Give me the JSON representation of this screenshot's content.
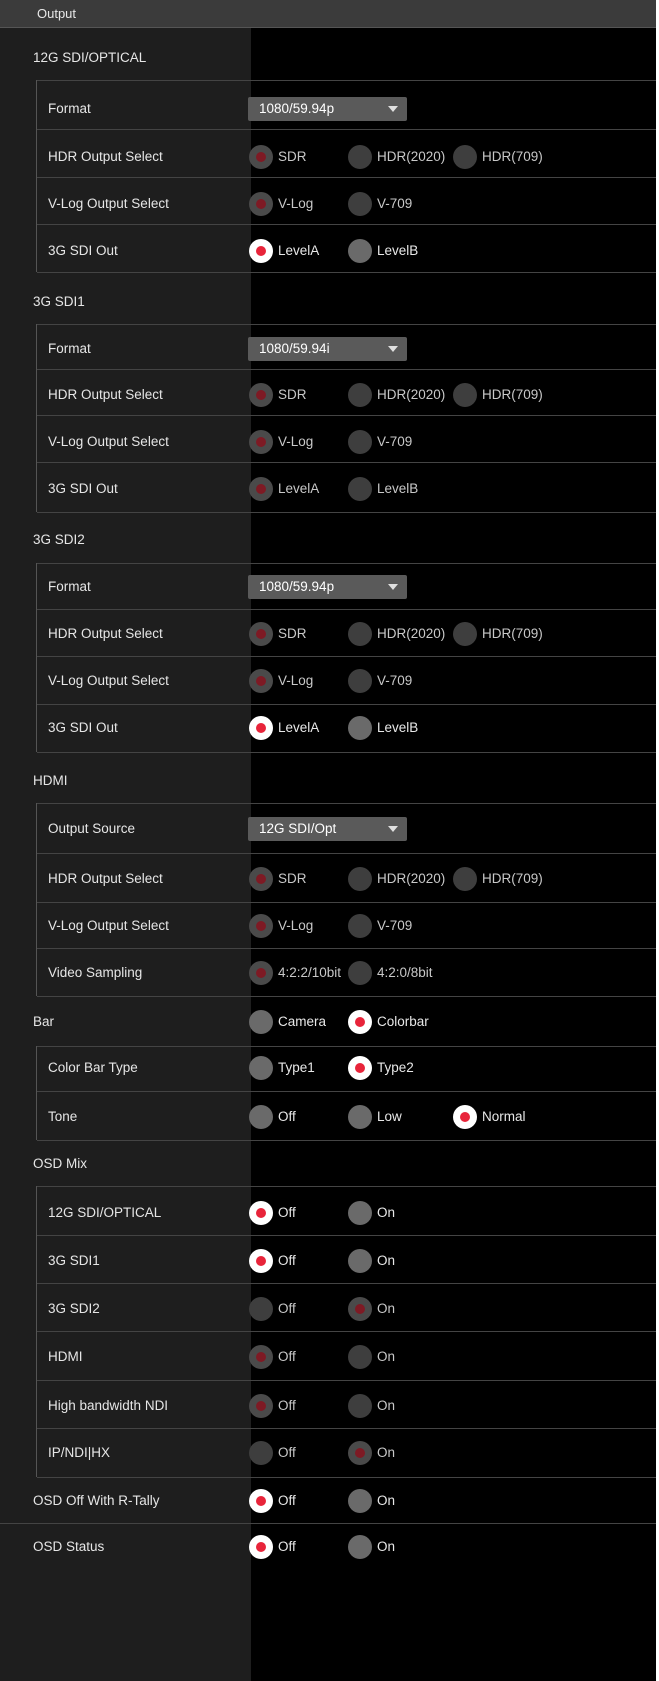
{
  "header": {
    "title": "Output"
  },
  "sections": [
    {
      "id": "sdi12g",
      "title": "12G SDI/OPTICAL",
      "rows": [
        {
          "label": "Format",
          "type": "select",
          "value": "1080/59.94p"
        },
        {
          "label": "HDR Output Select",
          "type": "radio",
          "enabled": false,
          "options": [
            {
              "label": "SDR",
              "selected": true
            },
            {
              "label": "HDR(2020)",
              "selected": false
            },
            {
              "label": "HDR(709)",
              "selected": false
            }
          ]
        },
        {
          "label": "V-Log Output Select",
          "type": "radio",
          "enabled": false,
          "options": [
            {
              "label": "V-Log",
              "selected": true
            },
            {
              "label": "V-709",
              "selected": false
            }
          ]
        },
        {
          "label": "3G SDI Out",
          "type": "radio",
          "enabled": true,
          "options": [
            {
              "label": "LevelA",
              "selected": true
            },
            {
              "label": "LevelB",
              "selected": false
            }
          ]
        }
      ]
    },
    {
      "id": "sdi3g1",
      "title": "3G SDI1",
      "rows": [
        {
          "label": "Format",
          "type": "select",
          "value": "1080/59.94i"
        },
        {
          "label": "HDR Output Select",
          "type": "radio",
          "enabled": false,
          "options": [
            {
              "label": "SDR",
              "selected": true
            },
            {
              "label": "HDR(2020)",
              "selected": false
            },
            {
              "label": "HDR(709)",
              "selected": false
            }
          ]
        },
        {
          "label": "V-Log Output Select",
          "type": "radio",
          "enabled": false,
          "options": [
            {
              "label": "V-Log",
              "selected": true
            },
            {
              "label": "V-709",
              "selected": false
            }
          ]
        },
        {
          "label": "3G SDI Out",
          "type": "radio",
          "enabled": false,
          "options": [
            {
              "label": "LevelA",
              "selected": true
            },
            {
              "label": "LevelB",
              "selected": false
            }
          ]
        }
      ]
    },
    {
      "id": "sdi3g2",
      "title": "3G SDI2",
      "rows": [
        {
          "label": "Format",
          "type": "select",
          "value": "1080/59.94p"
        },
        {
          "label": "HDR Output Select",
          "type": "radio",
          "enabled": false,
          "options": [
            {
              "label": "SDR",
              "selected": true
            },
            {
              "label": "HDR(2020)",
              "selected": false
            },
            {
              "label": "HDR(709)",
              "selected": false
            }
          ]
        },
        {
          "label": "V-Log Output Select",
          "type": "radio",
          "enabled": false,
          "options": [
            {
              "label": "V-Log",
              "selected": true
            },
            {
              "label": "V-709",
              "selected": false
            }
          ]
        },
        {
          "label": "3G SDI Out",
          "type": "radio",
          "enabled": true,
          "options": [
            {
              "label": "LevelA",
              "selected": true
            },
            {
              "label": "LevelB",
              "selected": false
            }
          ]
        }
      ]
    },
    {
      "id": "hdmi",
      "title": "HDMI",
      "rows": [
        {
          "label": "Output Source",
          "type": "select",
          "value": "12G SDI/Opt"
        },
        {
          "label": "HDR Output Select",
          "type": "radio",
          "enabled": false,
          "options": [
            {
              "label": "SDR",
              "selected": true
            },
            {
              "label": "HDR(2020)",
              "selected": false
            },
            {
              "label": "HDR(709)",
              "selected": false
            }
          ]
        },
        {
          "label": "V-Log Output Select",
          "type": "radio",
          "enabled": false,
          "options": [
            {
              "label": "V-Log",
              "selected": true
            },
            {
              "label": "V-709",
              "selected": false
            }
          ]
        },
        {
          "label": "Video Sampling",
          "type": "radio",
          "enabled": false,
          "options": [
            {
              "label": "4:2:2/10bit",
              "selected": true
            },
            {
              "label": "4:2:0/8bit",
              "selected": false
            }
          ]
        }
      ]
    },
    {
      "id": "bar",
      "title": "Bar",
      "options": [
        {
          "label": "Camera",
          "selected": false
        },
        {
          "label": "Colorbar",
          "selected": true
        }
      ],
      "rows": [
        {
          "label": "Color Bar Type",
          "type": "radio",
          "enabled": true,
          "options": [
            {
              "label": "Type1",
              "selected": false
            },
            {
              "label": "Type2",
              "selected": true
            }
          ]
        },
        {
          "label": "Tone",
          "type": "radio",
          "enabled": true,
          "options": [
            {
              "label": "Off",
              "selected": false
            },
            {
              "label": "Low",
              "selected": false
            },
            {
              "label": "Normal",
              "selected": true
            }
          ]
        }
      ]
    },
    {
      "id": "osdmix",
      "title": "OSD Mix",
      "rows": [
        {
          "label": "12G SDI/OPTICAL",
          "type": "radio",
          "enabled": true,
          "options": [
            {
              "label": "Off",
              "selected": true
            },
            {
              "label": "On",
              "selected": false
            }
          ]
        },
        {
          "label": "3G SDI1",
          "type": "radio",
          "enabled": true,
          "options": [
            {
              "label": "Off",
              "selected": true
            },
            {
              "label": "On",
              "selected": false
            }
          ]
        },
        {
          "label": "3G SDI2",
          "type": "radio",
          "enabled": false,
          "options": [
            {
              "label": "Off",
              "selected": false
            },
            {
              "label": "On",
              "selected": true
            }
          ]
        },
        {
          "label": "HDMI",
          "type": "radio",
          "enabled": false,
          "options": [
            {
              "label": "Off",
              "selected": true
            },
            {
              "label": "On",
              "selected": false
            }
          ]
        },
        {
          "label": "High bandwidth NDI",
          "type": "radio",
          "enabled": false,
          "options": [
            {
              "label": "Off",
              "selected": true
            },
            {
              "label": "On",
              "selected": false
            }
          ]
        },
        {
          "label": "IP/NDI|HX",
          "type": "radio",
          "enabled": false,
          "options": [
            {
              "label": "Off",
              "selected": false
            },
            {
              "label": "On",
              "selected": true
            }
          ]
        }
      ]
    },
    {
      "id": "osdofftally",
      "title": "OSD Off With R-Tally",
      "options": [
        {
          "label": "Off",
          "selected": true
        },
        {
          "label": "On",
          "selected": false
        }
      ],
      "rows": []
    },
    {
      "id": "osdstatus",
      "title": "OSD Status",
      "options": [
        {
          "label": "Off",
          "selected": true
        },
        {
          "label": "On",
          "selected": false
        }
      ],
      "rows": []
    }
  ]
}
